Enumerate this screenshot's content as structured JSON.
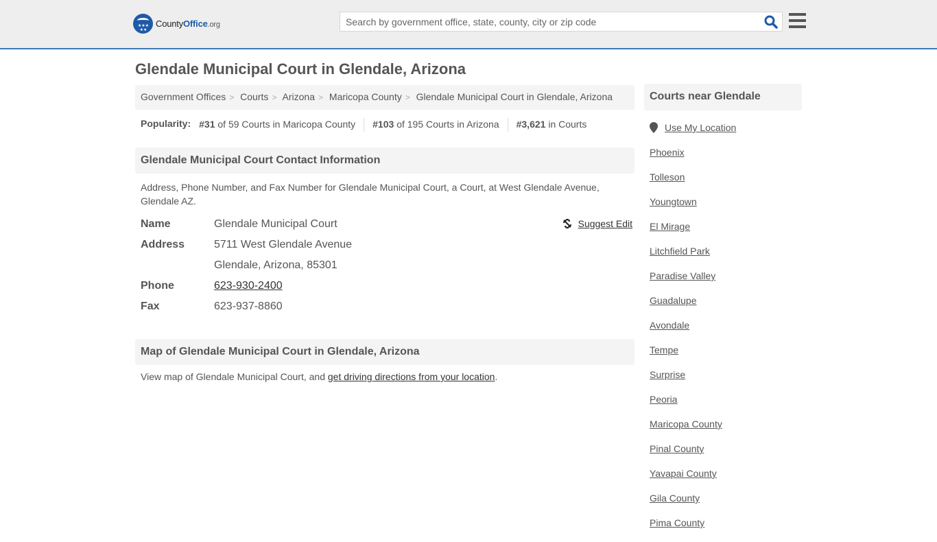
{
  "header": {
    "logo": {
      "pre": "County",
      "bold": "Office",
      "suffix": ".org"
    },
    "search_placeholder": "Search by government office, state, county, city or zip code",
    "search_icon": "search-icon",
    "menu_icon": "hamburger-menu-icon",
    "accent_color": "#1e5aa8"
  },
  "page_title": "Glendale Municipal Court in Glendale, Arizona",
  "breadcrumb": [
    {
      "label": "Government Offices"
    },
    {
      "label": "Courts"
    },
    {
      "label": "Arizona"
    },
    {
      "label": "Maricopa County"
    },
    {
      "label": "Glendale Municipal Court in Glendale, Arizona"
    }
  ],
  "popularity": {
    "label": "Popularity:",
    "items": [
      {
        "rank": "#31",
        "text": "of 59 Courts in Maricopa County"
      },
      {
        "rank": "#103",
        "text": "of 195 Courts in Arizona"
      },
      {
        "rank": "#3,621",
        "text": "in Courts"
      }
    ]
  },
  "contact": {
    "heading": "Glendale Municipal Court Contact Information",
    "description": "Address, Phone Number, and Fax Number for Glendale Municipal Court, a Court, at West Glendale Avenue, Glendale AZ.",
    "suggest_edit": "Suggest Edit",
    "rows": [
      {
        "key": "Name",
        "value": "Glendale Municipal Court"
      },
      {
        "key": "Address",
        "value": "5711 West Glendale Avenue"
      },
      {
        "key": "",
        "value": "Glendale, Arizona, 85301"
      },
      {
        "key": "Phone",
        "value": "623-930-2400"
      },
      {
        "key": "Fax",
        "value": "623-937-8860"
      }
    ]
  },
  "map": {
    "heading": "Map of Glendale Municipal Court in Glendale, Arizona",
    "text_before": "View map of Glendale Municipal Court, and ",
    "link": "get driving directions from your location",
    "text_after": "."
  },
  "sidebar": {
    "heading": "Courts near Glendale",
    "use_location": "Use My Location",
    "items": [
      {
        "label": "Phoenix"
      },
      {
        "label": "Tolleson"
      },
      {
        "label": "Youngtown"
      },
      {
        "label": "El Mirage"
      },
      {
        "label": "Litchfield Park"
      },
      {
        "label": "Paradise Valley"
      },
      {
        "label": "Guadalupe"
      },
      {
        "label": "Avondale"
      },
      {
        "label": "Tempe"
      },
      {
        "label": "Surprise"
      },
      {
        "label": "Peoria"
      },
      {
        "label": "Maricopa County"
      },
      {
        "label": "Pinal County"
      },
      {
        "label": "Yavapai County"
      },
      {
        "label": "Gila County"
      },
      {
        "label": "Pima County"
      }
    ]
  }
}
